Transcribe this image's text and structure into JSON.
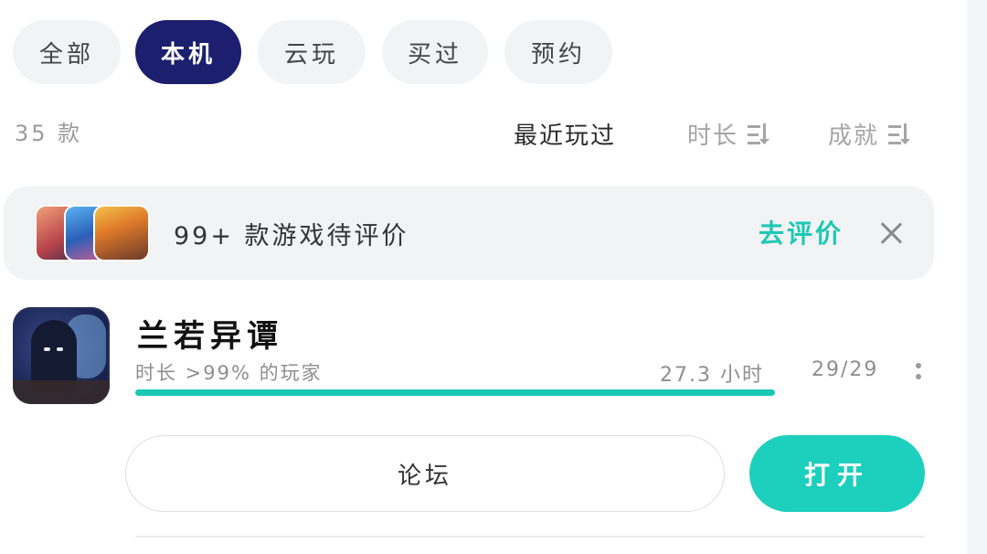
{
  "tabs": [
    {
      "label": "全部",
      "active": false
    },
    {
      "label": "本机",
      "active": true
    },
    {
      "label": "云玩",
      "active": false
    },
    {
      "label": "买过",
      "active": false
    },
    {
      "label": "预约",
      "active": false
    }
  ],
  "count_label": "35 款",
  "sort": {
    "recent": "最近玩过",
    "duration": "时长",
    "achievement": "成就"
  },
  "banner": {
    "text": "99+ 款游戏待评价",
    "action": "去评价",
    "accent": "#1ec8b4"
  },
  "game": {
    "title": "兰若异谭",
    "meta": "时长 >99% 的玩家",
    "hours": "27.3 小时",
    "achievements": "29/29",
    "progress": 1.0,
    "forum_label": "论坛",
    "open_label": "打开"
  },
  "colors": {
    "active_tab": "#1c1f6e",
    "primary": "#1dcfbd"
  }
}
